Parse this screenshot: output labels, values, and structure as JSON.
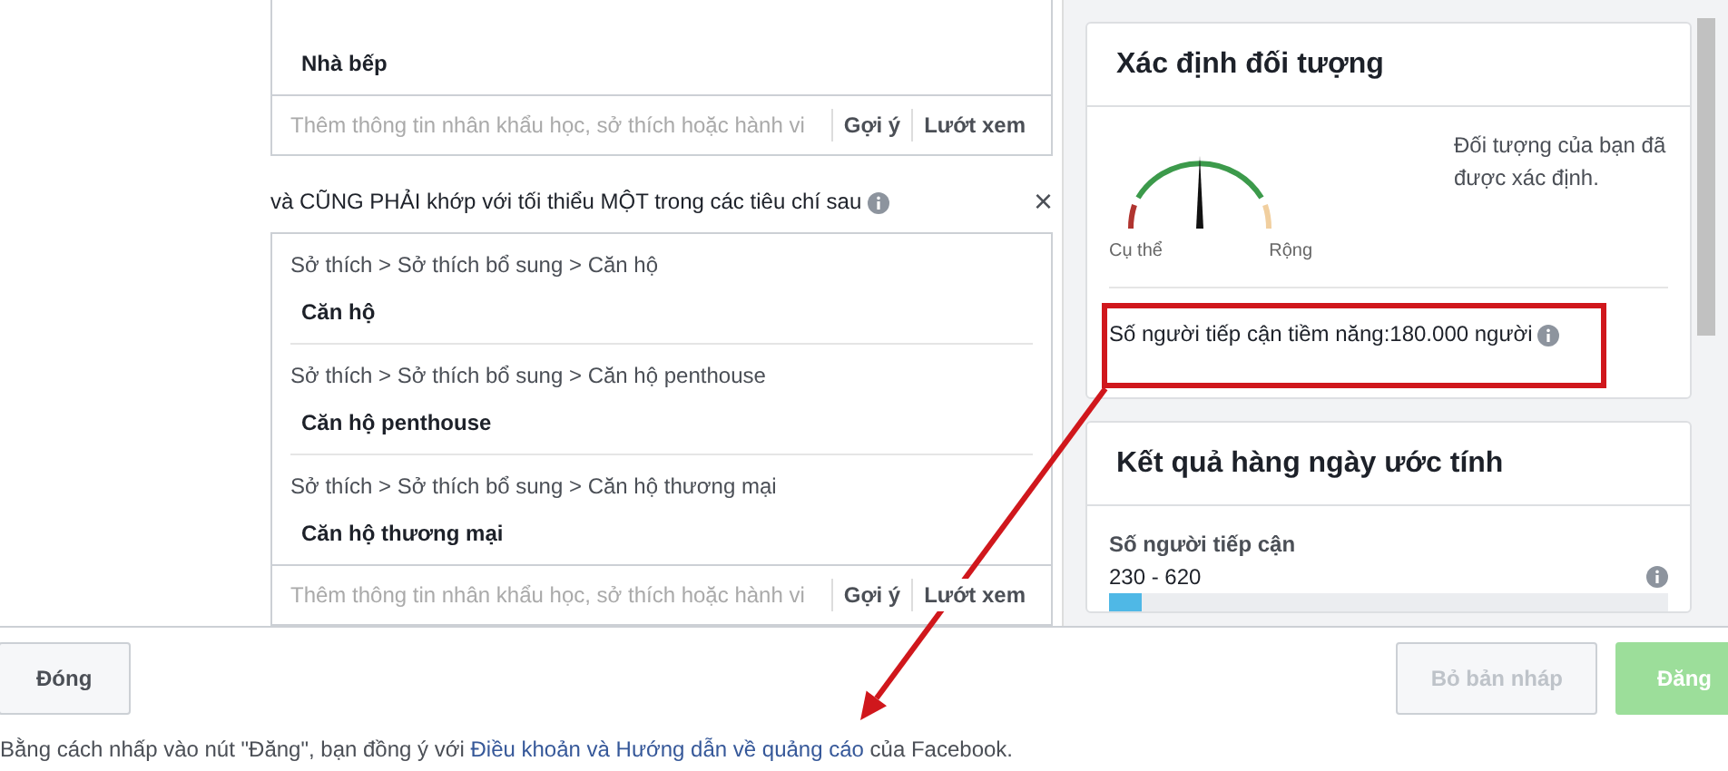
{
  "first_group": {
    "items": [
      {
        "name": "Nhà bếp"
      }
    ],
    "input": {
      "placeholder": "Thêm thông tin nhân khẩu học, sở thích hoặc hành vi"
    },
    "actions": [
      "Gợi ý",
      "Lướt xem"
    ]
  },
  "second_group": {
    "heading": "và CŨNG PHẢI khớp với tối thiểu MỘT trong các tiêu chí sau",
    "close": "×",
    "items": [
      {
        "path": "Sở thích > Sở thích bổ sung > Căn hộ",
        "name": "Căn hộ"
      },
      {
        "path": "Sở thích > Sở thích bổ sung > Căn hộ penthouse",
        "name": "Căn hộ penthouse"
      },
      {
        "path": "Sở thích > Sở thích bổ sung > Căn hộ thương mại",
        "name": "Căn hộ thương mại"
      }
    ],
    "input": {
      "placeholder": "Thêm thông tin nhân khẩu học, sở thích hoặc hành vi"
    },
    "actions": [
      "Gợi ý",
      "Lướt xem"
    ]
  },
  "audience_card": {
    "title": "Xác định đối tượng",
    "gauge_left": "Cụ thể",
    "gauge_right": "Rộng",
    "level": 0.5,
    "message": "Đối tượng của bạn đã được xác định.",
    "potential_reach": "Số người tiếp cận tiềm năng:180.000 người"
  },
  "results_card": {
    "title": "Kết quả hàng ngày ước tính",
    "metric": "Số người tiếp cận",
    "range": "230 - 620",
    "level": 0.06
  },
  "footer": {
    "close_button": {
      "label": "Đóng",
      "disabled": false
    },
    "draft_button": {
      "label": "Bỏ bản nháp",
      "disabled": true
    },
    "publish_button": {
      "label": "Đăng",
      "disabled": true
    },
    "terms": "Bằng cách nhấp vào nút \"Đăng\", bạn đồng ý với ",
    "terms_link": "Điều khoản và Hướng dẫn về quảng cáo",
    "terms_end": " của Facebook."
  }
}
